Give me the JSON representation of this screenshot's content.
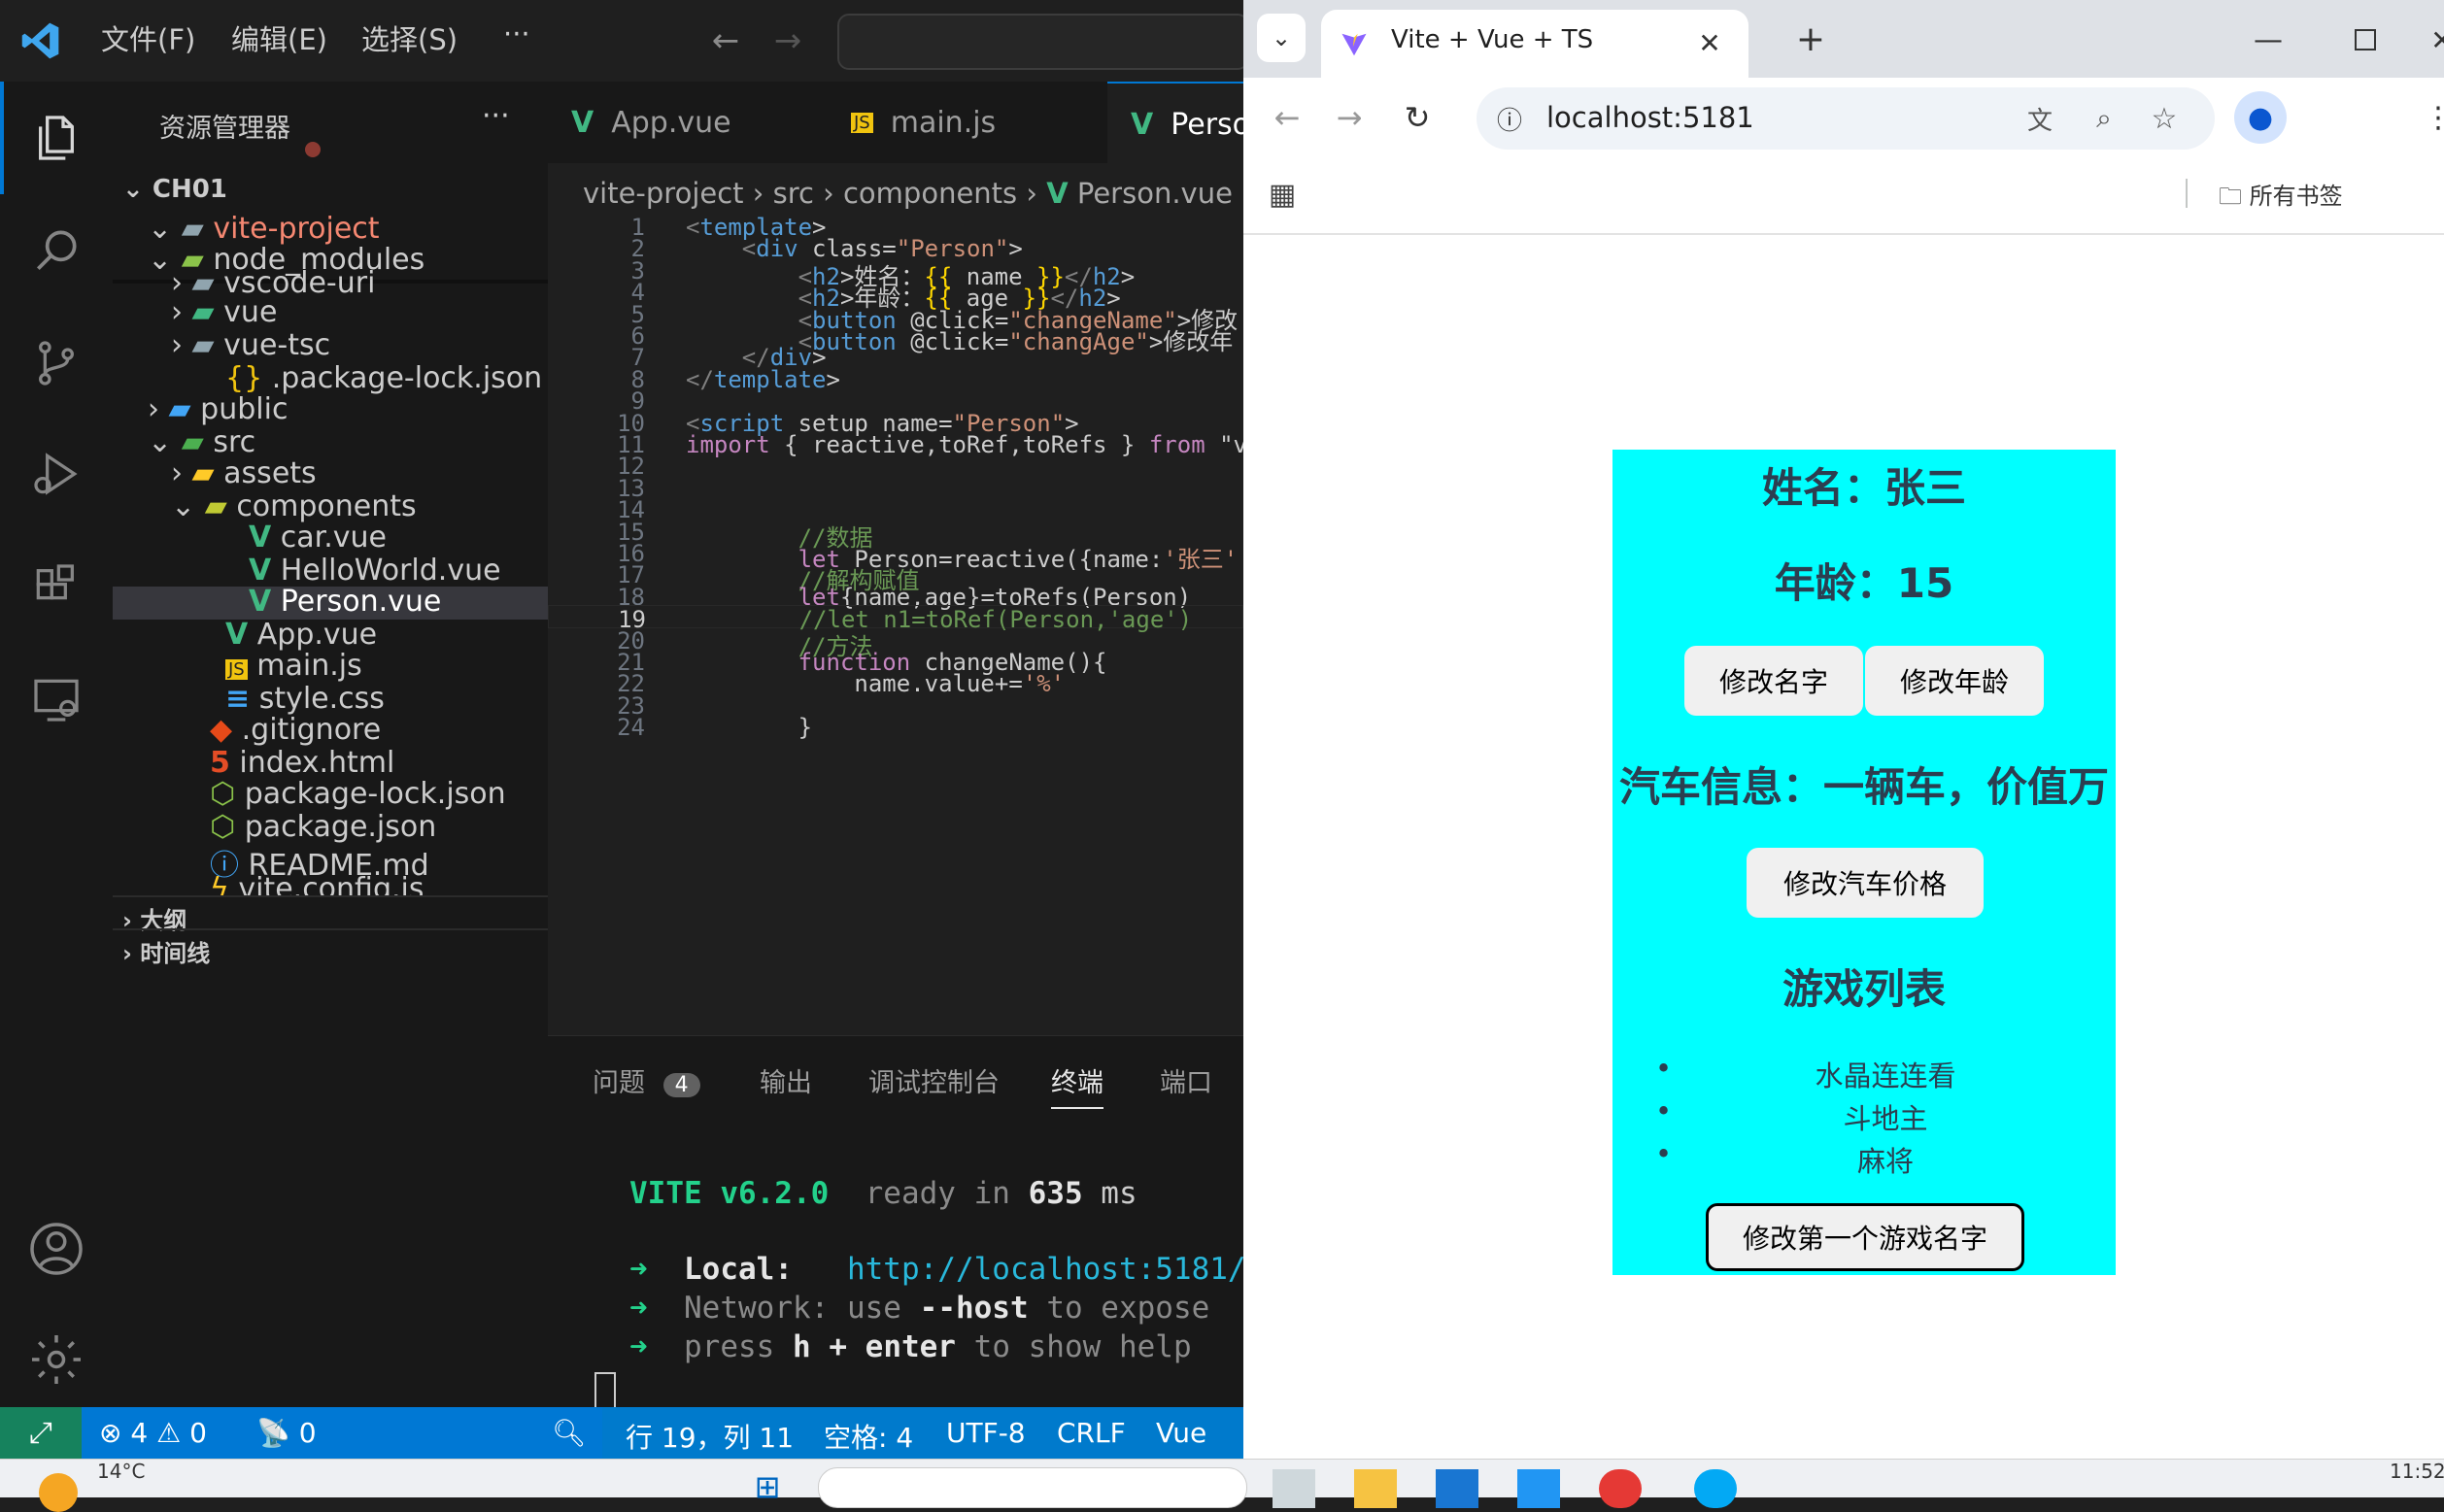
{
  "vscode": {
    "menu": [
      "文件(F)",
      "编辑(E)",
      "选择(S)",
      "···"
    ],
    "sidebar": {
      "title": "资源管理器",
      "more": "···",
      "root": "CH01",
      "items": [
        {
          "label": "vite-project",
          "kind": "folder-open"
        },
        {
          "label": "node_modules",
          "kind": "folder-open"
        },
        {
          "label": "vscode-uri",
          "kind": "folder"
        },
        {
          "label": "vue",
          "kind": "folder"
        },
        {
          "label": "vue-tsc",
          "kind": "folder"
        },
        {
          "label": ".package-lock.json",
          "kind": "json"
        },
        {
          "label": "public",
          "kind": "folder"
        },
        {
          "label": "src",
          "kind": "folder-open"
        },
        {
          "label": "assets",
          "kind": "folder"
        },
        {
          "label": "components",
          "kind": "folder-open"
        },
        {
          "label": "car.vue",
          "kind": "vue"
        },
        {
          "label": "HelloWorld.vue",
          "kind": "vue"
        },
        {
          "label": "Person.vue",
          "kind": "vue"
        },
        {
          "label": "App.vue",
          "kind": "vue"
        },
        {
          "label": "main.js",
          "kind": "js"
        },
        {
          "label": "style.css",
          "kind": "css"
        },
        {
          "label": ".gitignore",
          "kind": "git"
        },
        {
          "label": "index.html",
          "kind": "html"
        },
        {
          "label": "package-lock.json",
          "kind": "node"
        },
        {
          "label": "package.json",
          "kind": "node"
        },
        {
          "label": "README.md",
          "kind": "info"
        },
        {
          "label": "vite.config.js",
          "kind": "js"
        }
      ],
      "outline": "大纲",
      "timeline": "时间线"
    },
    "tabs": [
      "App.vue",
      "main.js",
      "Person.vue"
    ],
    "breadcrumb": [
      "vite-project",
      "src",
      "components",
      "Person.vue"
    ],
    "code": [
      {
        "n": "1",
        "t": "<template>"
      },
      {
        "n": "2",
        "t": "    <div class=\"Person\">"
      },
      {
        "n": "3",
        "t": "        <h2>姓名：{{ name }}</h2>"
      },
      {
        "n": "4",
        "t": "        <h2>年龄：{{ age }}</h2>"
      },
      {
        "n": "5",
        "t": "        <button @click=\"changeName\">修改"
      },
      {
        "n": "6",
        "t": "        <button @click=\"changAge\">修改年"
      },
      {
        "n": "7",
        "t": "    </div>"
      },
      {
        "n": "8",
        "t": "</template>"
      },
      {
        "n": "9",
        "t": ""
      },
      {
        "n": "10",
        "t": "<script setup name=\"Person\">"
      },
      {
        "n": "11",
        "t": "import { reactive,toRef,toRefs } from \"v"
      },
      {
        "n": "12",
        "t": ""
      },
      {
        "n": "13",
        "t": ""
      },
      {
        "n": "14",
        "t": ""
      },
      {
        "n": "15",
        "t": "        //数据"
      },
      {
        "n": "16",
        "t": "        let Person=reactive({name:'张三'"
      },
      {
        "n": "17",
        "t": "        //解构赋值"
      },
      {
        "n": "18",
        "t": "        let{name,age}=toRefs(Person)"
      },
      {
        "n": "19",
        "t": "        //let n1=toRef(Person,'age')"
      },
      {
        "n": "20",
        "t": "        //方法"
      },
      {
        "n": "21",
        "t": "        function changeName(){"
      },
      {
        "n": "22",
        "t": "            name.value+='%'"
      },
      {
        "n": "23",
        "t": ""
      },
      {
        "n": "24",
        "t": "        }"
      }
    ],
    "panel": {
      "tabs": [
        "问题",
        "输出",
        "调试控制台",
        "终端",
        "端口"
      ],
      "problems_count": "4",
      "terminal": {
        "vite": "VITE v6.2.0",
        "ready": "ready in",
        "ms_value": "635",
        "ms": "ms",
        "local_label": "Local:",
        "local_url": "http://localhost:5181/",
        "network_label": "Network:",
        "network_text": "use",
        "network_flag": "--host",
        "network_rest": "to expose",
        "help_text": "press",
        "help_key": "h + enter",
        "help_rest": "to show help"
      }
    },
    "status": {
      "errors": "4",
      "warnings": "0",
      "ports": "0",
      "position": "行 19，列 11",
      "spaces": "空格: 4",
      "encoding": "UTF-8",
      "eol": "CRLF",
      "language": "Vue"
    }
  },
  "chrome": {
    "tab_title": "Vite + Vue + TS",
    "url": "localhost:5181",
    "bookmarks": "所有书签"
  },
  "app": {
    "name_line": "姓名：张三",
    "age_line": "年龄：15",
    "btn_change_name": "修改名字",
    "btn_change_age": "修改年龄",
    "car_line": "汽车信息：一辆车，价值万",
    "btn_change_car": "修改汽车价格",
    "games_title": "游戏列表",
    "games": [
      "水晶连连看",
      "斗地主",
      "麻将"
    ],
    "btn_change_game": "修改第一个游戏名字"
  },
  "taskbar": {
    "weather": "14°C",
    "time": "11:52"
  }
}
